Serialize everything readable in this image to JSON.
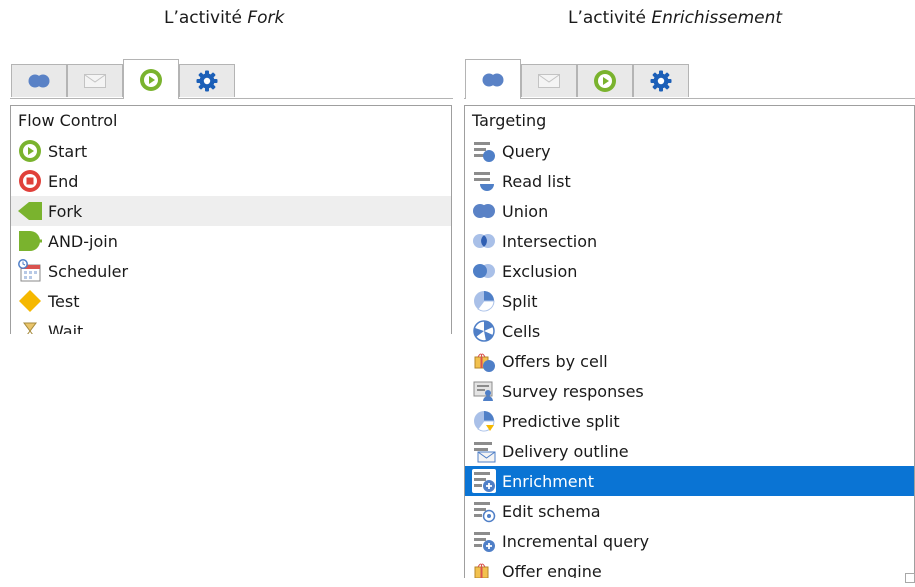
{
  "captions": {
    "left_prefix": "L’activité ",
    "left_italic": "Fork",
    "right_prefix": "L’activité ",
    "right_italic": "Enrichissement"
  },
  "tab_icons": [
    "targeting-icon",
    "envelope-icon",
    "play-icon",
    "gear-icon"
  ],
  "left_panel": {
    "active_tab": 2,
    "header": "Flow Control",
    "items": [
      {
        "label": "Start",
        "icon": "start-icon"
      },
      {
        "label": "End",
        "icon": "end-icon"
      },
      {
        "label": "Fork",
        "icon": "fork-icon"
      },
      {
        "label": "AND-join",
        "icon": "and-join-icon"
      },
      {
        "label": "Scheduler",
        "icon": "scheduler-icon"
      },
      {
        "label": "Test",
        "icon": "test-icon"
      },
      {
        "label": "Wait",
        "icon": "wait-icon"
      }
    ]
  },
  "right_panel": {
    "active_tab": 0,
    "header": "Targeting",
    "items": [
      {
        "label": "Query",
        "icon": "query-icon"
      },
      {
        "label": "Read list",
        "icon": "read-list-icon"
      },
      {
        "label": "Union",
        "icon": "union-icon"
      },
      {
        "label": "Intersection",
        "icon": "intersection-icon"
      },
      {
        "label": "Exclusion",
        "icon": "exclusion-icon"
      },
      {
        "label": "Split",
        "icon": "split-icon"
      },
      {
        "label": "Cells",
        "icon": "cells-icon"
      },
      {
        "label": "Offers by cell",
        "icon": "offers-by-cell-icon"
      },
      {
        "label": "Survey responses",
        "icon": "survey-responses-icon"
      },
      {
        "label": "Predictive split",
        "icon": "predictive-split-icon"
      },
      {
        "label": "Delivery outline",
        "icon": "delivery-outline-icon"
      },
      {
        "label": "Enrichment",
        "icon": "enrichment-icon"
      },
      {
        "label": "Edit schema",
        "icon": "edit-schema-icon"
      },
      {
        "label": "Incremental query",
        "icon": "incremental-query-icon"
      },
      {
        "label": "Offer engine",
        "icon": "offer-engine-icon"
      }
    ]
  },
  "colors": {
    "selection": "#0a74d4",
    "hover_row": "#eeeeee",
    "flow_green": "#7ab32e",
    "flow_red": "#e0403a",
    "targeting_blue": "#4f7fc7",
    "test_yellow": "#f5b800"
  }
}
